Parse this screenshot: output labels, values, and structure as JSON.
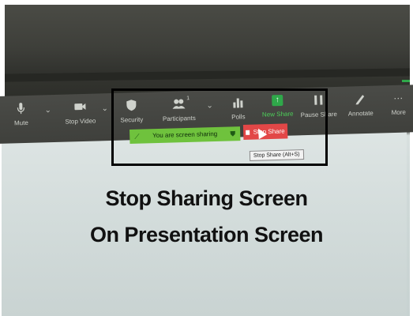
{
  "toolbar": {
    "mute_label": "Mute",
    "stop_video_label": "Stop Video",
    "security_label": "Security",
    "participants_label": "Participants",
    "participants_count": "1",
    "polls_label": "Polls",
    "new_share_label": "New Share",
    "pause_share_label": "Pause Share",
    "annotate_label": "Annotate",
    "more_label": "More"
  },
  "sharing_bar": {
    "status_text": "You are screen sharing",
    "stop_share_label": "Stop Share",
    "tooltip_text": "Stop Share (Alt+S)"
  },
  "caption": {
    "line1": "Stop Sharing Screen",
    "line2": "On Presentation Screen"
  },
  "colors": {
    "share_green": "#6fc23d",
    "stop_red": "#e24747",
    "toolbar_bg": "#43443f"
  }
}
